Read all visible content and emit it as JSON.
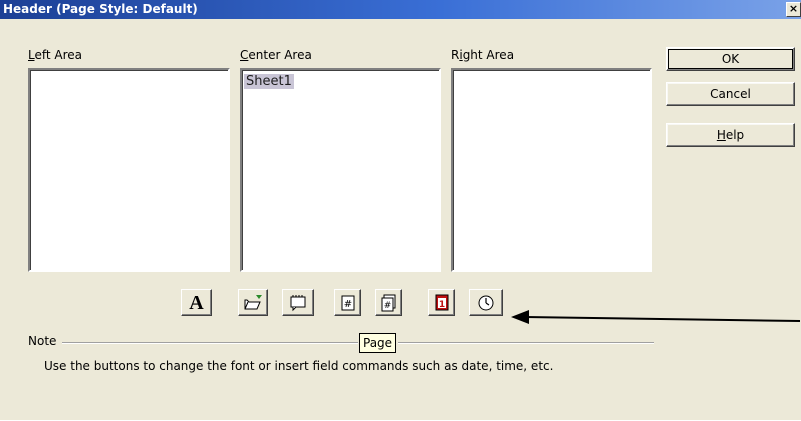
{
  "window": {
    "title": "Header (Page Style: Default)",
    "close_glyph": "×"
  },
  "areas": {
    "left": {
      "label_first": "L",
      "label_rest": "eft Area"
    },
    "center": {
      "label_first": "C",
      "label_rest": "enter Area",
      "content": "Sheet1"
    },
    "right": {
      "label_pre": "R",
      "label_first": "i",
      "label_rest": "ght Area"
    }
  },
  "buttons": {
    "ok": "OK",
    "cancel": "Cancel",
    "help_first": "H",
    "help_rest": "elp"
  },
  "toolbar": {
    "font_glyph": "A",
    "icons": [
      "font-icon",
      "title-icon",
      "sheet-name-icon",
      "page-number-icon",
      "total-pages-icon",
      "date-icon",
      "time-icon"
    ]
  },
  "tooltip": {
    "text": "Page"
  },
  "note": {
    "label": "Note",
    "text": "Use the buttons to change the font or insert field commands such as date, time, etc."
  }
}
